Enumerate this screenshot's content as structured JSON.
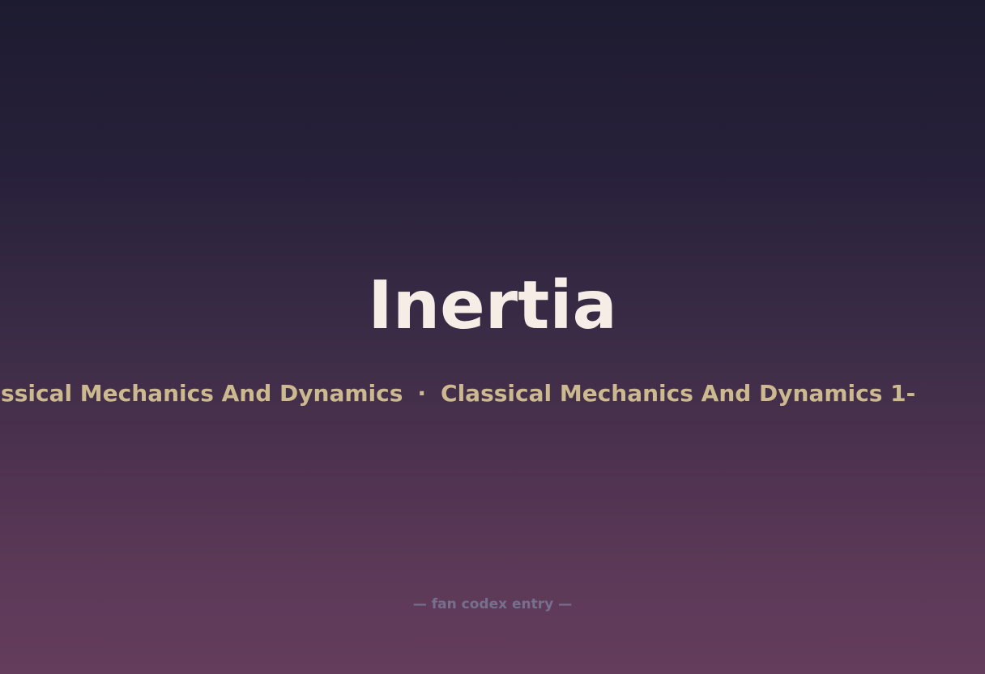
{
  "title": "Inertia",
  "ticker": {
    "items": [
      "Classical Mechanics And Dynamics",
      "Classical Mechanics And Dynamics 1-"
    ],
    "separator": "·"
  },
  "footer": {
    "text": "— fan codex entry —"
  },
  "colors": {
    "title": "#f6ede6",
    "ticker": "#cdb990",
    "footer": "#76708f",
    "bg_top": "#1d1b30",
    "bg_bottom": "#643c5c"
  }
}
